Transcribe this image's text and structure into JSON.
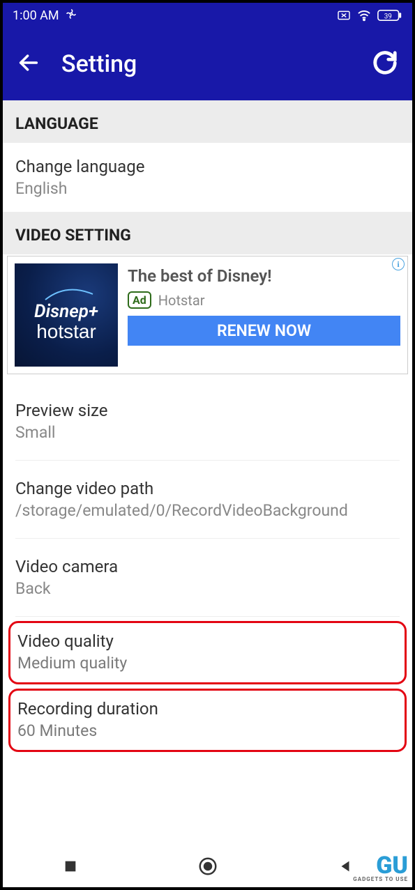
{
  "statusbar": {
    "time": "1:00 AM",
    "battery": "39"
  },
  "appbar": {
    "title": "Setting"
  },
  "sections": {
    "language": {
      "header": "LANGUAGE",
      "item": {
        "title": "Change language",
        "value": "English"
      }
    },
    "video": {
      "header": "VIDEO SETTING",
      "preview": {
        "title": "Preview size",
        "value": "Small"
      },
      "path": {
        "title": "Change video path",
        "value": "/storage/emulated/0/RecordVideoBackground"
      },
      "camera": {
        "title": "Video camera",
        "value": "Back"
      },
      "quality": {
        "title": "Video quality",
        "value": "Medium quality"
      },
      "duration": {
        "title": "Recording duration",
        "value": "60 Minutes"
      }
    }
  },
  "ad": {
    "headline": "The best of Disney!",
    "tag": "Ad",
    "advertiser": "Hotstar",
    "cta": "RENEW NOW",
    "logo_line1": "Disnep+",
    "logo_line2": "hotstar"
  },
  "watermark": {
    "main": "GU",
    "sub": "GADGETS TO USE"
  }
}
